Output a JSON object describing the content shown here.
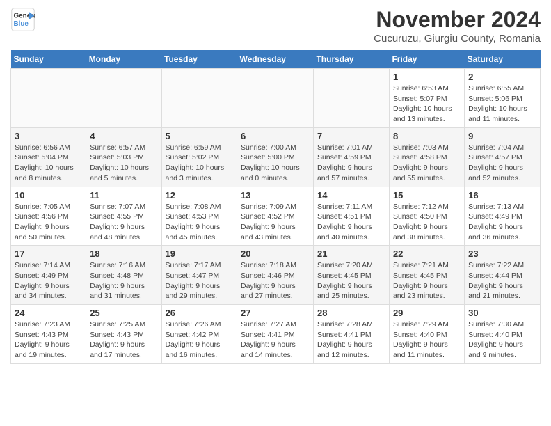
{
  "logo": {
    "line1": "General",
    "line2": "Blue"
  },
  "title": "November 2024",
  "location": "Cucuruzu, Giurgiu County, Romania",
  "days_of_week": [
    "Sunday",
    "Monday",
    "Tuesday",
    "Wednesday",
    "Thursday",
    "Friday",
    "Saturday"
  ],
  "weeks": [
    [
      {
        "day": "",
        "info": ""
      },
      {
        "day": "",
        "info": ""
      },
      {
        "day": "",
        "info": ""
      },
      {
        "day": "",
        "info": ""
      },
      {
        "day": "",
        "info": ""
      },
      {
        "day": "1",
        "info": "Sunrise: 6:53 AM\nSunset: 5:07 PM\nDaylight: 10 hours and 13 minutes."
      },
      {
        "day": "2",
        "info": "Sunrise: 6:55 AM\nSunset: 5:06 PM\nDaylight: 10 hours and 11 minutes."
      }
    ],
    [
      {
        "day": "3",
        "info": "Sunrise: 6:56 AM\nSunset: 5:04 PM\nDaylight: 10 hours and 8 minutes."
      },
      {
        "day": "4",
        "info": "Sunrise: 6:57 AM\nSunset: 5:03 PM\nDaylight: 10 hours and 5 minutes."
      },
      {
        "day": "5",
        "info": "Sunrise: 6:59 AM\nSunset: 5:02 PM\nDaylight: 10 hours and 3 minutes."
      },
      {
        "day": "6",
        "info": "Sunrise: 7:00 AM\nSunset: 5:00 PM\nDaylight: 10 hours and 0 minutes."
      },
      {
        "day": "7",
        "info": "Sunrise: 7:01 AM\nSunset: 4:59 PM\nDaylight: 9 hours and 57 minutes."
      },
      {
        "day": "8",
        "info": "Sunrise: 7:03 AM\nSunset: 4:58 PM\nDaylight: 9 hours and 55 minutes."
      },
      {
        "day": "9",
        "info": "Sunrise: 7:04 AM\nSunset: 4:57 PM\nDaylight: 9 hours and 52 minutes."
      }
    ],
    [
      {
        "day": "10",
        "info": "Sunrise: 7:05 AM\nSunset: 4:56 PM\nDaylight: 9 hours and 50 minutes."
      },
      {
        "day": "11",
        "info": "Sunrise: 7:07 AM\nSunset: 4:55 PM\nDaylight: 9 hours and 48 minutes."
      },
      {
        "day": "12",
        "info": "Sunrise: 7:08 AM\nSunset: 4:53 PM\nDaylight: 9 hours and 45 minutes."
      },
      {
        "day": "13",
        "info": "Sunrise: 7:09 AM\nSunset: 4:52 PM\nDaylight: 9 hours and 43 minutes."
      },
      {
        "day": "14",
        "info": "Sunrise: 7:11 AM\nSunset: 4:51 PM\nDaylight: 9 hours and 40 minutes."
      },
      {
        "day": "15",
        "info": "Sunrise: 7:12 AM\nSunset: 4:50 PM\nDaylight: 9 hours and 38 minutes."
      },
      {
        "day": "16",
        "info": "Sunrise: 7:13 AM\nSunset: 4:49 PM\nDaylight: 9 hours and 36 minutes."
      }
    ],
    [
      {
        "day": "17",
        "info": "Sunrise: 7:14 AM\nSunset: 4:49 PM\nDaylight: 9 hours and 34 minutes."
      },
      {
        "day": "18",
        "info": "Sunrise: 7:16 AM\nSunset: 4:48 PM\nDaylight: 9 hours and 31 minutes."
      },
      {
        "day": "19",
        "info": "Sunrise: 7:17 AM\nSunset: 4:47 PM\nDaylight: 9 hours and 29 minutes."
      },
      {
        "day": "20",
        "info": "Sunrise: 7:18 AM\nSunset: 4:46 PM\nDaylight: 9 hours and 27 minutes."
      },
      {
        "day": "21",
        "info": "Sunrise: 7:20 AM\nSunset: 4:45 PM\nDaylight: 9 hours and 25 minutes."
      },
      {
        "day": "22",
        "info": "Sunrise: 7:21 AM\nSunset: 4:45 PM\nDaylight: 9 hours and 23 minutes."
      },
      {
        "day": "23",
        "info": "Sunrise: 7:22 AM\nSunset: 4:44 PM\nDaylight: 9 hours and 21 minutes."
      }
    ],
    [
      {
        "day": "24",
        "info": "Sunrise: 7:23 AM\nSunset: 4:43 PM\nDaylight: 9 hours and 19 minutes."
      },
      {
        "day": "25",
        "info": "Sunrise: 7:25 AM\nSunset: 4:43 PM\nDaylight: 9 hours and 17 minutes."
      },
      {
        "day": "26",
        "info": "Sunrise: 7:26 AM\nSunset: 4:42 PM\nDaylight: 9 hours and 16 minutes."
      },
      {
        "day": "27",
        "info": "Sunrise: 7:27 AM\nSunset: 4:41 PM\nDaylight: 9 hours and 14 minutes."
      },
      {
        "day": "28",
        "info": "Sunrise: 7:28 AM\nSunset: 4:41 PM\nDaylight: 9 hours and 12 minutes."
      },
      {
        "day": "29",
        "info": "Sunrise: 7:29 AM\nSunset: 4:40 PM\nDaylight: 9 hours and 11 minutes."
      },
      {
        "day": "30",
        "info": "Sunrise: 7:30 AM\nSunset: 4:40 PM\nDaylight: 9 hours and 9 minutes."
      }
    ]
  ]
}
